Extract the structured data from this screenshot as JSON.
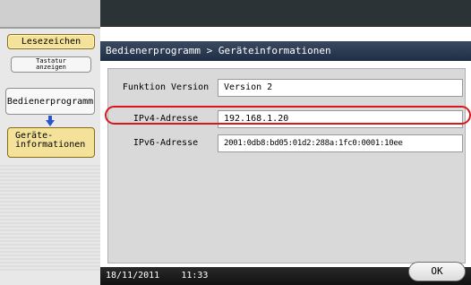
{
  "sidebar": {
    "bookmark_label": "Lesezeichen",
    "keyboard_line1": "Tastatur",
    "keyboard_line2": "anzeigen",
    "utility_label": "Bedienerprogramm",
    "device_line1": "Geräte-",
    "device_line2": "informationen"
  },
  "header": {
    "breadcrumb": "Bedienerprogramm > Geräteinformationen"
  },
  "info": {
    "rows": [
      {
        "label": "Funktion Version",
        "value": "Version 2"
      },
      {
        "label": "IPv4-Adresse",
        "value": "192.168.1.20"
      },
      {
        "label": "IPv6-Adresse",
        "value": "2001:0db8:bd05:01d2:288a:1fc0:0001:10ee"
      }
    ]
  },
  "status": {
    "date": "18/11/2011",
    "time": "11:33"
  },
  "ok_label": "OK",
  "colors": {
    "highlight": "#d8161e",
    "active_button": "#f4e29a",
    "titlebar": "#2a3a52"
  }
}
